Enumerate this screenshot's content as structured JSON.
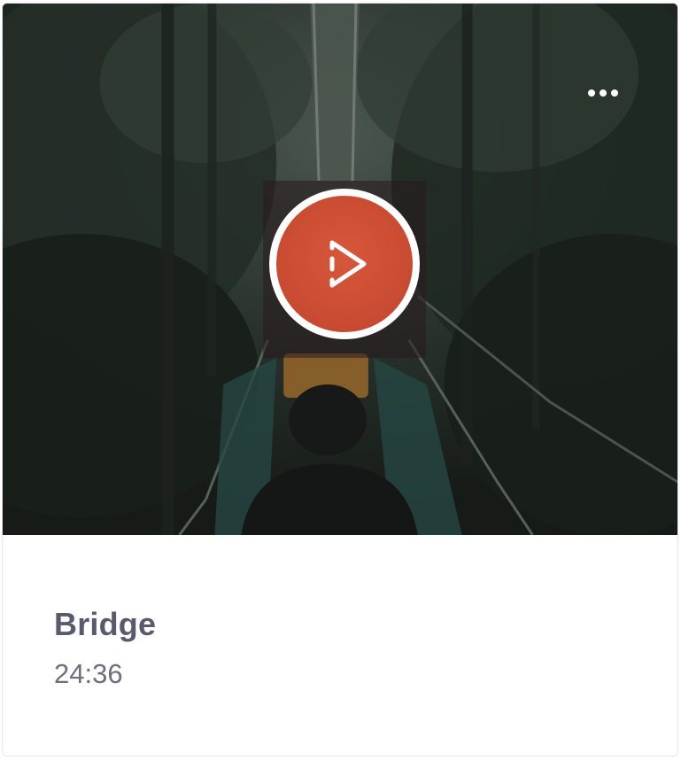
{
  "card": {
    "title": "Bridge",
    "duration": "24:36"
  },
  "media": {
    "thumbnail": "forest-rope-bridge-photo",
    "overlay_icon": "play-icon",
    "menu_icon": "more-horizontal-icon"
  },
  "colors": {
    "play_accent": "#c84a30",
    "title_text": "#595a6d",
    "duration_text": "#6d6e7e",
    "card_border": "#e6e6ea"
  }
}
